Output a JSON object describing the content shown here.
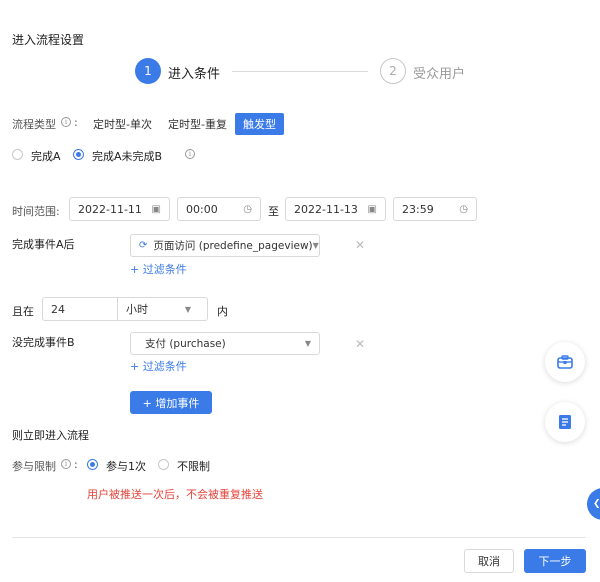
{
  "page_title": "进入流程设置",
  "steps": [
    {
      "number": "1",
      "label": "进入条件"
    },
    {
      "number": "2",
      "label": "受众用户"
    }
  ],
  "flow_type": {
    "label": "流程类型",
    "colon": ":",
    "options": [
      "定时型-单次",
      "定时型-重复",
      "触发型"
    ]
  },
  "mode_options": [
    "完成A",
    "完成A未完成B"
  ],
  "time_range": {
    "label": "时间范围:",
    "start_date": "2022-11-11",
    "start_time": "00:00",
    "separator": "至",
    "end_date": "2022-11-13",
    "end_time": "23:59"
  },
  "event_a": {
    "label": "完成事件A后",
    "value": "页面访问 (predefine_pageview)",
    "filter_link": "+ 过滤条件"
  },
  "within": {
    "prefix": "且在",
    "amount": "24",
    "unit": "小时",
    "suffix": "内"
  },
  "event_b": {
    "label": "没完成事件B",
    "value": "支付 (purchase)",
    "filter_link": "+ 过滤条件",
    "add_button": "+ 增加事件"
  },
  "enter_text": "则立即进入流程",
  "participation": {
    "label": "参与限制",
    "colon": ":",
    "options": [
      "参与1次",
      "不限制"
    ],
    "warning": "用户被推送一次后，不会被重复推送"
  },
  "footer": {
    "cancel": "取消",
    "next": "下一步"
  },
  "colors": {
    "primary": "#3b7be8",
    "warning": "#e5433b"
  }
}
